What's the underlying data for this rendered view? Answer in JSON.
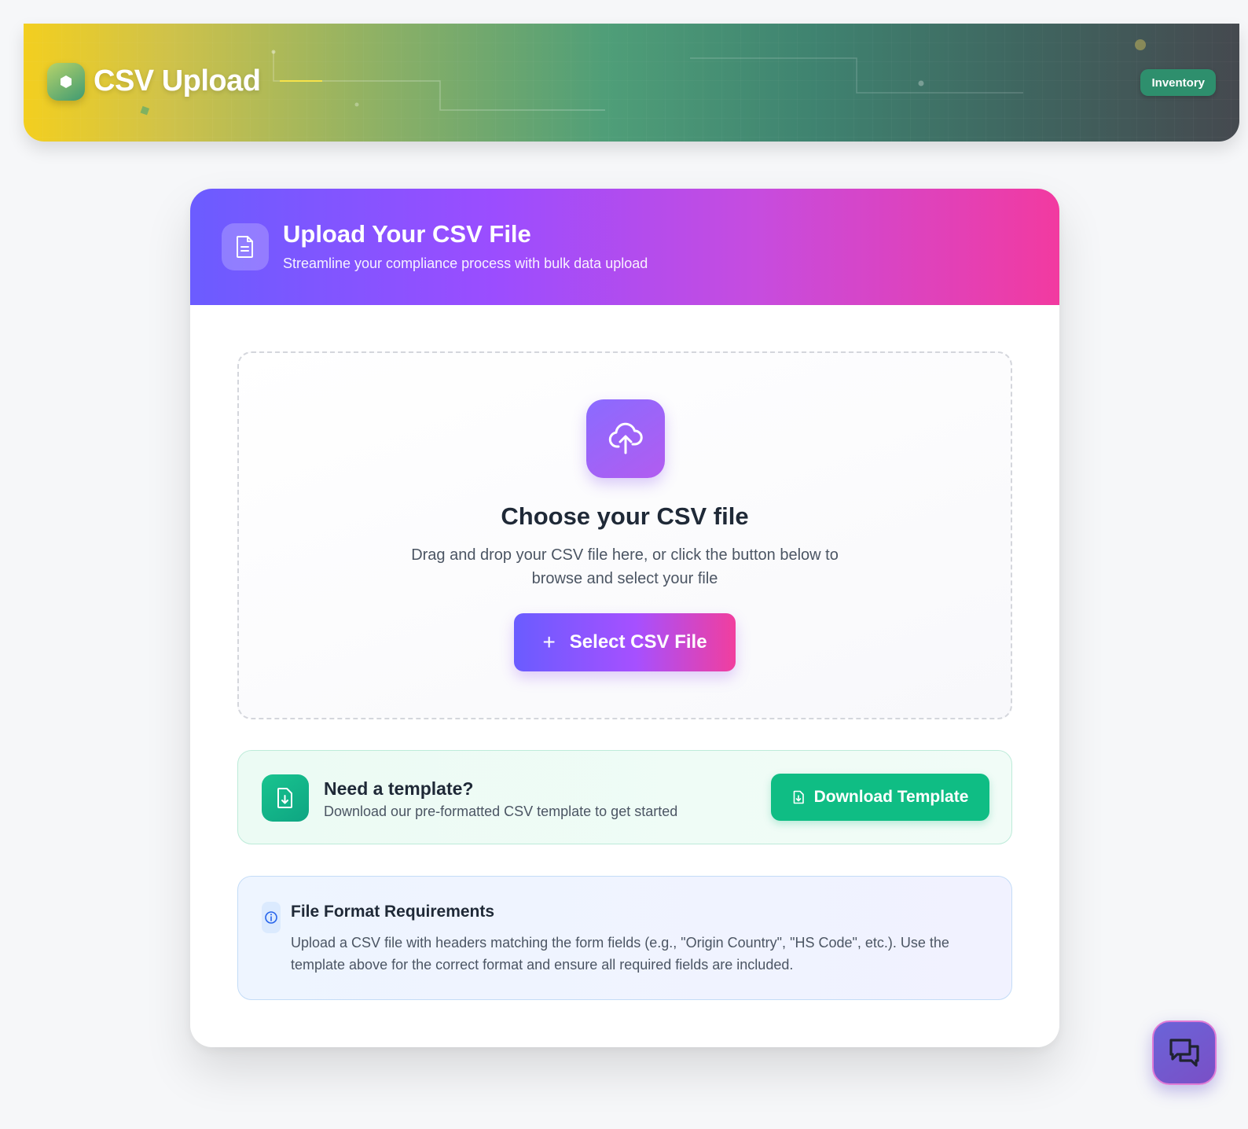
{
  "header": {
    "title": "CSV Upload",
    "badge": "Inventory"
  },
  "card": {
    "title": "Upload Your CSV File",
    "subtitle": "Streamline your compliance process with bulk data upload"
  },
  "dropzone": {
    "title": "Choose your CSV file",
    "description": "Drag and drop your CSV file here, or click the button below to browse and select your file",
    "button_label": "Select CSV File"
  },
  "template": {
    "title": "Need a template?",
    "description": "Download our pre-formatted CSV template to get started",
    "button_label": "Download Template"
  },
  "requirements": {
    "title": "File Format Requirements",
    "description": "Upload a CSV file with headers matching the form fields (e.g., \"Origin Country\", \"HS Code\", etc.). Use the template above for the correct format and ensure all required fields are included."
  },
  "icons": {
    "brand": "cube-icon",
    "card_header": "document-icon",
    "upload": "cloud-upload-icon",
    "select": "plus-icon",
    "template": "file-download-icon",
    "download": "file-download-icon",
    "info": "info-icon",
    "chat": "chat-icon"
  },
  "colors": {
    "accent_purple": "#9b4dff",
    "accent_pink": "#f23aa0",
    "success_green": "#0fbd84",
    "inventory_green": "#2e8f6d"
  }
}
